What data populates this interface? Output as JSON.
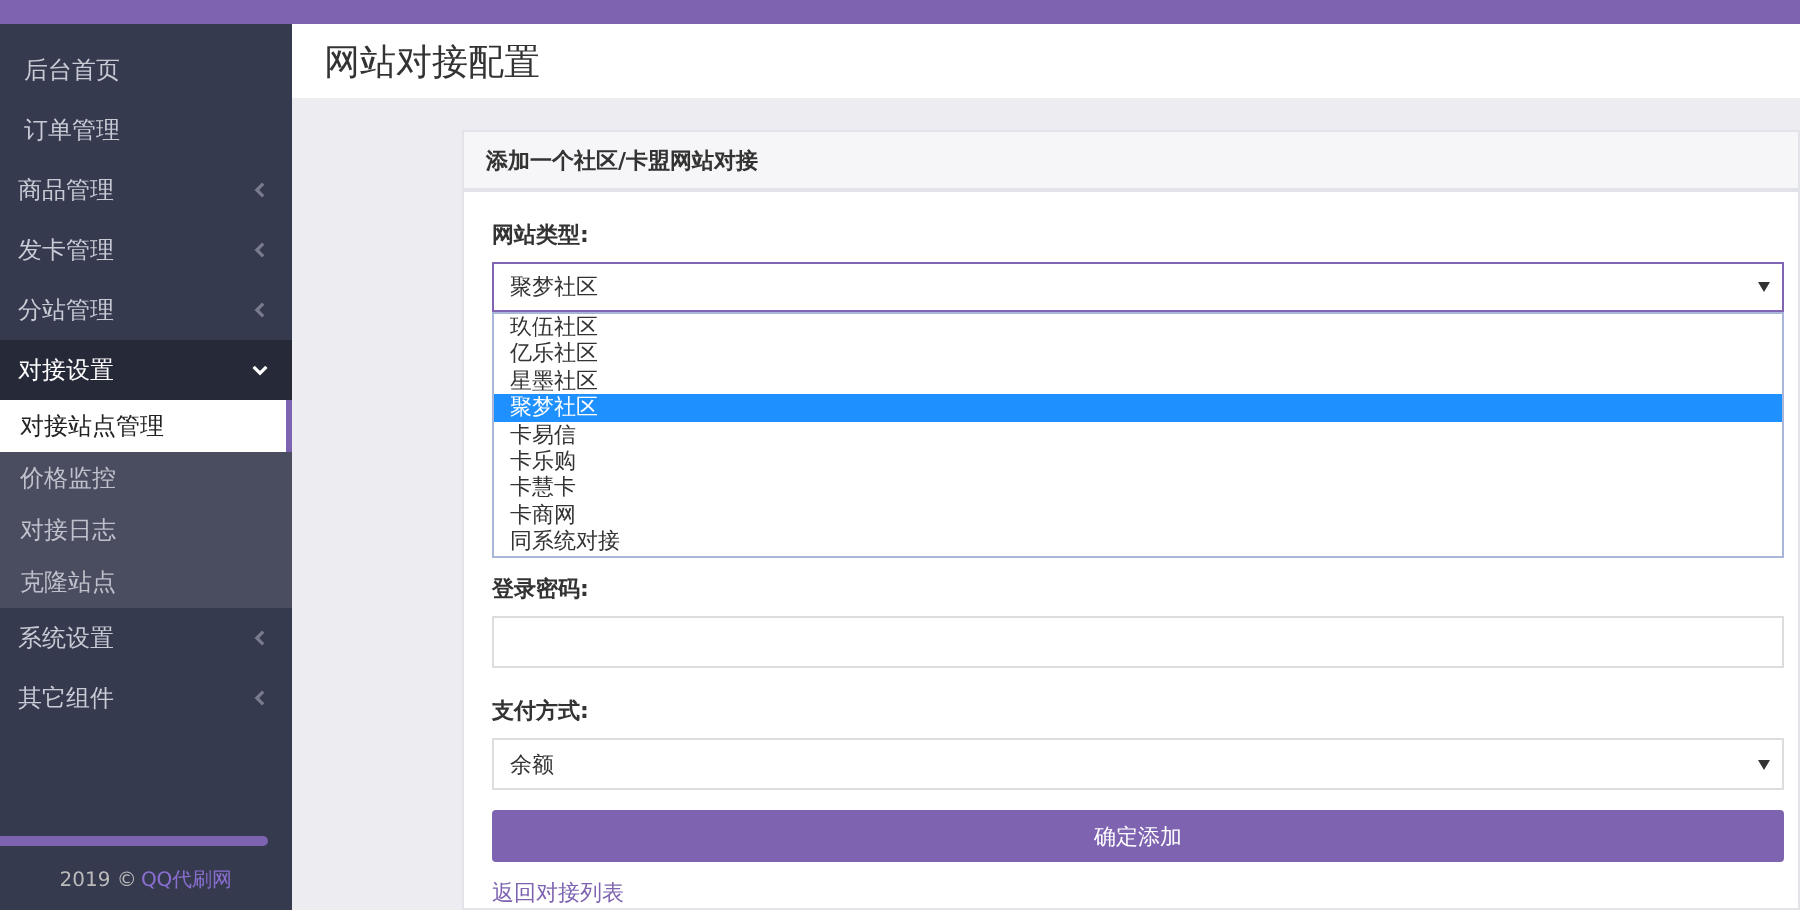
{
  "sidebar": {
    "items": [
      {
        "label": "后台首页",
        "kind": "link"
      },
      {
        "label": "订单管理",
        "kind": "link"
      },
      {
        "label": "商品管理",
        "kind": "group",
        "expanded": false
      },
      {
        "label": "发卡管理",
        "kind": "group",
        "expanded": false
      },
      {
        "label": "分站管理",
        "kind": "group",
        "expanded": false
      },
      {
        "label": "对接设置",
        "kind": "group",
        "expanded": true,
        "children": [
          {
            "label": "对接站点管理",
            "selected": true
          },
          {
            "label": "价格监控",
            "selected": false
          },
          {
            "label": "对接日志",
            "selected": false
          },
          {
            "label": "克隆站点",
            "selected": false
          }
        ]
      },
      {
        "label": "系统设置",
        "kind": "group",
        "expanded": false
      },
      {
        "label": "其它组件",
        "kind": "group",
        "expanded": false
      }
    ],
    "footer": {
      "year": "2019 ©",
      "site": "QQ代刷网"
    }
  },
  "page_title": "网站对接配置",
  "panel": {
    "title": "添加一个社区/卡盟网站对接",
    "site_type": {
      "label": "网站类型:",
      "value": "聚梦社区",
      "options": [
        {
          "label": "玖伍社区",
          "selected": false
        },
        {
          "label": "亿乐社区",
          "selected": false
        },
        {
          "label": "星墨社区",
          "selected": false
        },
        {
          "label": "聚梦社区",
          "selected": true
        },
        {
          "label": "卡易信",
          "selected": false
        },
        {
          "label": "卡乐购",
          "selected": false
        },
        {
          "label": "卡慧卡",
          "selected": false
        },
        {
          "label": "卡商网",
          "selected": false
        },
        {
          "label": "同系统对接",
          "selected": false
        }
      ]
    },
    "password": {
      "label": "登录密码:"
    },
    "payment": {
      "label": "支付方式:",
      "value": "余额"
    },
    "submit": "确定添加",
    "back_link": "返回对接列表"
  }
}
